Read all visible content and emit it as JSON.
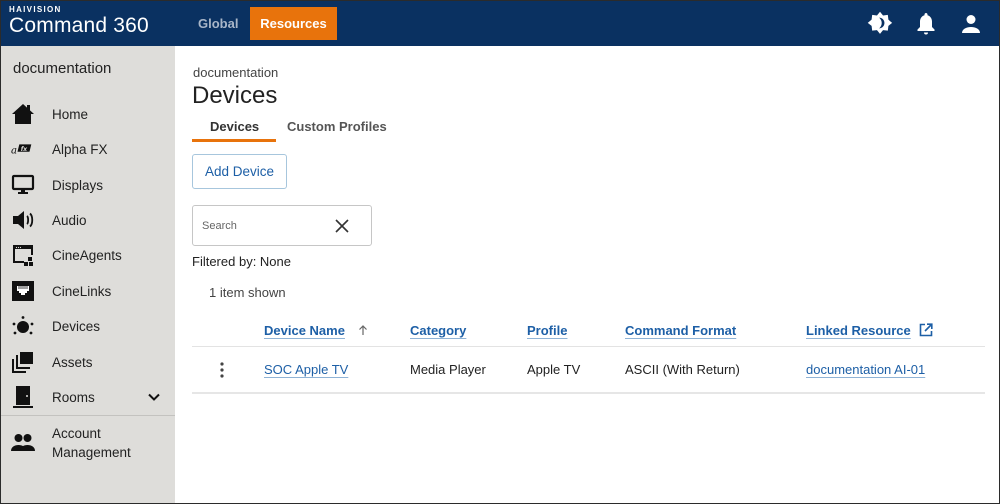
{
  "header": {
    "brand_small": "HAIVISION",
    "brand_big": "Command 360",
    "nav": [
      {
        "label": "Global",
        "active": false
      },
      {
        "label": "Resources",
        "active": true
      }
    ],
    "icons": [
      "theme-toggle-icon",
      "bell-icon",
      "user-icon"
    ],
    "colors": {
      "bar": "#0a3161",
      "active_tab": "#e8730c"
    }
  },
  "sidebar": {
    "title": "documentation",
    "items": [
      {
        "label": "Home",
        "icon": "home-icon"
      },
      {
        "label": "Alpha FX",
        "icon": "alpha-fx-icon"
      },
      {
        "label": "Displays",
        "icon": "monitor-icon"
      },
      {
        "label": "Audio",
        "icon": "speaker-icon"
      },
      {
        "label": "CineAgents",
        "icon": "cineagents-icon"
      },
      {
        "label": "CineLinks",
        "icon": "ethernet-port-icon"
      },
      {
        "label": "Devices",
        "icon": "devices-icon"
      },
      {
        "label": "Assets",
        "icon": "assets-icon"
      },
      {
        "label": "Rooms",
        "icon": "door-icon",
        "expandable": true
      }
    ],
    "account": {
      "label_line1": "Account",
      "label_line2": "Management",
      "icon": "people-icon"
    }
  },
  "main": {
    "breadcrumb": "documentation",
    "title": "Devices",
    "tabs": [
      {
        "label": "Devices",
        "active": true
      },
      {
        "label": "Custom Profiles",
        "active": false
      }
    ],
    "add_button": "Add Device",
    "search": {
      "placeholder": "Search",
      "value": ""
    },
    "filtered_by": "Filtered by: None",
    "items_shown": "1 item shown",
    "table": {
      "columns": [
        {
          "label": "Device Name",
          "sorted": "ascending"
        },
        {
          "label": "Category"
        },
        {
          "label": "Profile"
        },
        {
          "label": "Command Format"
        },
        {
          "label": "Linked Resource",
          "icon": "external-link-icon"
        }
      ],
      "rows": [
        {
          "device_name": "SOC Apple TV",
          "category": "Media Player",
          "profile": "Apple TV",
          "command_format": "ASCII (With Return)",
          "linked_resource": "documentation AI-01"
        }
      ]
    }
  }
}
